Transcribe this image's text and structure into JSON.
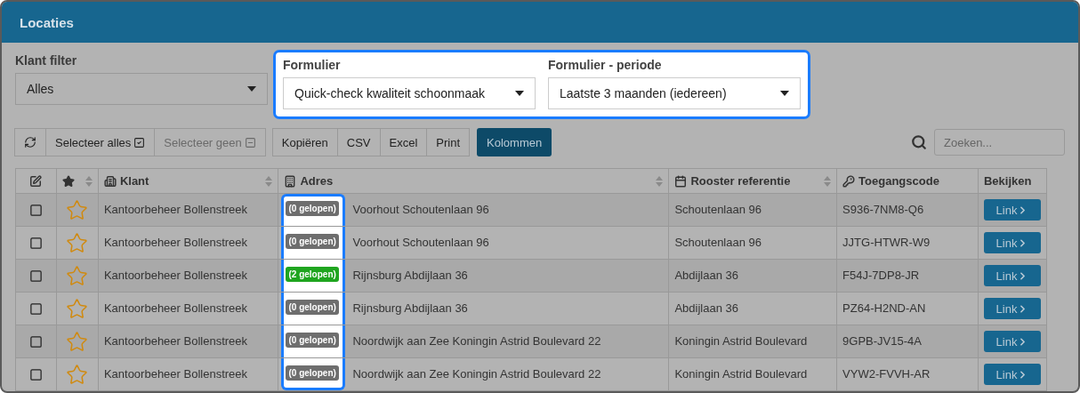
{
  "window": {
    "title": "Locaties"
  },
  "filters": [
    {
      "label": "Klant filter",
      "value": "Alles",
      "highlighted": false
    },
    {
      "label": "Formulier",
      "value": "Quick-check kwaliteit schoonmaak",
      "highlighted": true
    },
    {
      "label": "Formulier - periode",
      "value": "Laatste 3 maanden (iedereen)",
      "highlighted": true
    }
  ],
  "toolbar": {
    "groups": [
      [
        {
          "kind": "refresh",
          "disabled": false
        },
        {
          "label": "Selecteer alles",
          "kind": "check",
          "disabled": false
        },
        {
          "label": "Selecteer geen",
          "kind": "minus",
          "disabled": true
        }
      ],
      [
        {
          "label": "Kopiëren",
          "kind": "text",
          "disabled": false
        },
        {
          "label": "CSV",
          "kind": "text",
          "disabled": false
        },
        {
          "label": "Excel",
          "kind": "text",
          "disabled": false
        },
        {
          "label": "Print",
          "kind": "text",
          "disabled": false
        }
      ]
    ],
    "primary": "Kolommen",
    "search_placeholder": "Zoeken..."
  },
  "table": {
    "columns": [
      {
        "sortable": false
      },
      {
        "sortable": true
      },
      {
        "label": "Klant",
        "sortable": true
      },
      {
        "label": "Adres",
        "sortable": true
      },
      {
        "label": "Rooster referentie",
        "sortable": true
      },
      {
        "label": "Toegangscode",
        "sortable": false
      },
      {
        "label": "Bekijken",
        "sortable": false
      }
    ],
    "rows": [
      {
        "checked": false,
        "starred": false,
        "klant": "Kantoorbeheer Bollenstreek",
        "badge": "(0 gelopen)",
        "color": "#6e6e6e",
        "adres": "Voorhout Schoutenlaan 96",
        "rooster": "Schoutenlaan 96",
        "code": "S936-7NM8-Q6",
        "link": "Link"
      },
      {
        "checked": false,
        "starred": false,
        "klant": "Kantoorbeheer Bollenstreek",
        "badge": "(0 gelopen)",
        "color": "#6e6e6e",
        "adres": "Voorhout Schoutenlaan 96",
        "rooster": "Schoutenlaan 96",
        "code": "JJTG-HTWR-W9",
        "link": "Link"
      },
      {
        "checked": false,
        "starred": false,
        "klant": "Kantoorbeheer Bollenstreek",
        "badge": "(2 gelopen)",
        "color": "#1fa51f",
        "adres": "Rijnsburg Abdijlaan 36",
        "rooster": "Abdijlaan 36",
        "code": "F54J-7DP8-JR",
        "link": "Link"
      },
      {
        "checked": false,
        "starred": false,
        "klant": "Kantoorbeheer Bollenstreek",
        "badge": "(0 gelopen)",
        "color": "#6e6e6e",
        "adres": "Rijnsburg Abdijlaan 36",
        "rooster": "Abdijlaan 36",
        "code": "PZ64-H2ND-AN",
        "link": "Link"
      },
      {
        "checked": false,
        "starred": false,
        "klant": "Kantoorbeheer Bollenstreek",
        "badge": "(0 gelopen)",
        "color": "#6e6e6e",
        "adres": "Noordwijk aan Zee Koningin Astrid Boulevard 22",
        "rooster": "Koningin Astrid Boulevard",
        "code": "9GPB-JV15-4A",
        "link": "Link"
      },
      {
        "checked": false,
        "starred": false,
        "klant": "Kantoorbeheer Bollenstreek",
        "badge": "(0 gelopen)",
        "color": "#6e6e6e",
        "adres": "Noordwijk aan Zee Koningin Astrid Boulevard 22",
        "rooster": "Koningin Astrid Boulevard",
        "code": "VYW2-FVVH-AR",
        "link": "Link"
      }
    ]
  }
}
